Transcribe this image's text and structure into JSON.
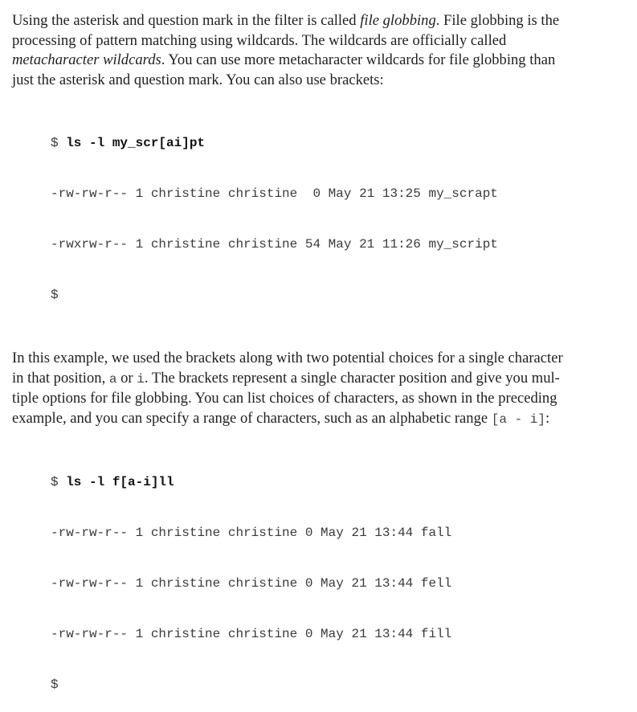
{
  "paragraph1": {
    "l1": [
      "Using the asterisk and question mark in the filter is called ",
      "file globbing",
      ". File globbing is the"
    ],
    "l2": "processing of pattern matching using wildcards. The wildcards are officially called",
    "l3": [
      "metacharacter wildcards",
      ". You can use more metacharacter wildcards for file globbing than"
    ],
    "l4": "just the asterisk and question mark. You can also use brackets:"
  },
  "code1": {
    "prompt": "$ ",
    "command": "ls -l my_scr[ai]pt",
    "out1": "-rw-rw-r-- 1 christine christine  0 May 21 13:25 my_scrapt",
    "out2": "-rwxrw-r-- 1 christine christine 54 May 21 11:26 my_script",
    "end": "$"
  },
  "paragraph2": {
    "l1": "In this example, we used the brackets along with two potential choices for a single character",
    "l2": [
      "in that position, ",
      "a",
      " or ",
      "i",
      ". The brackets represent a single character position and give you mul-"
    ],
    "l3": "tiple options for file globbing. You can list choices of characters, as shown in the preceding",
    "l4": [
      "example, and you can specify a range of characters, such as an alphabetic range ",
      "[a - i]",
      ":"
    ]
  },
  "code2": {
    "prompt": "$ ",
    "command": "ls -l f[a-i]ll",
    "out1": "-rw-rw-r-- 1 christine christine 0 May 21 13:44 fall",
    "out2": "-rw-rw-r-- 1 christine christine 0 May 21 13:44 fell",
    "out3": "-rw-rw-r-- 1 christine christine 0 May 21 13:44 fill",
    "end": "$"
  }
}
